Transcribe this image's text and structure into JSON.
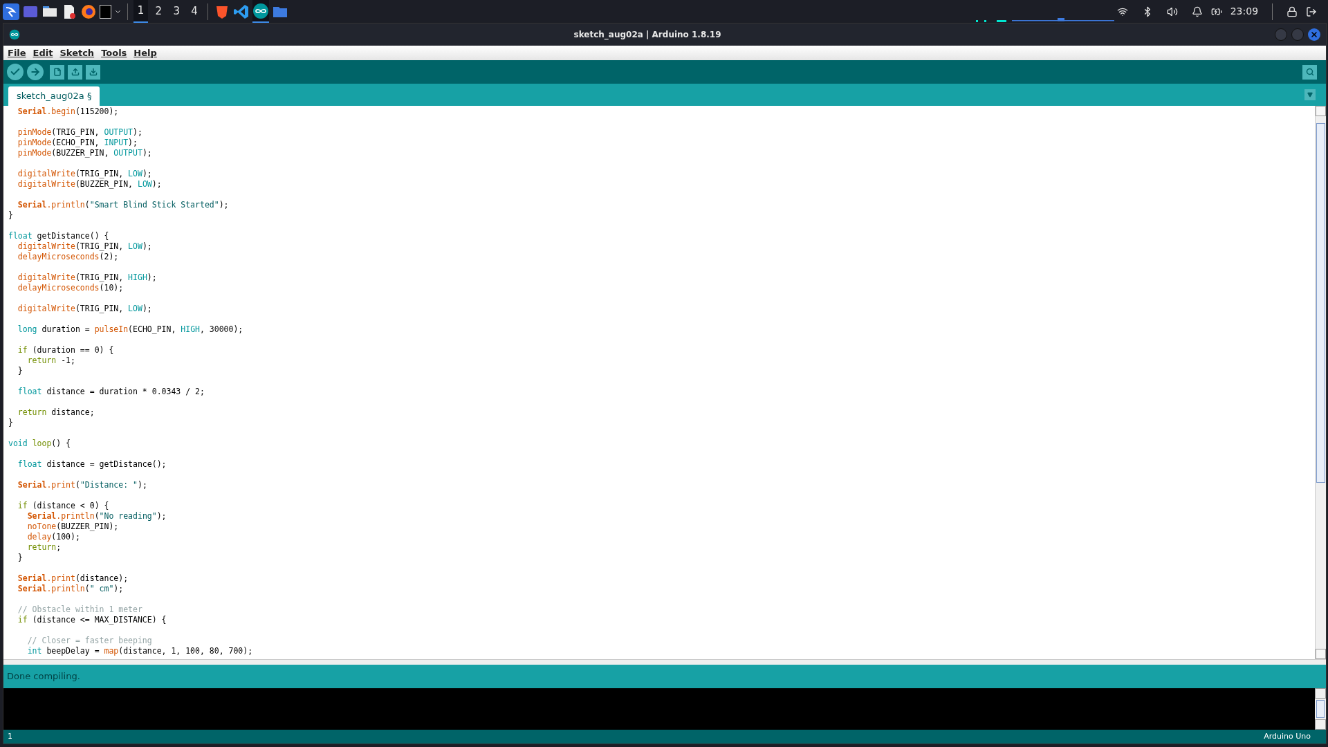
{
  "taskbar": {
    "apps": [
      {
        "selected": false
      },
      {
        "selected": false
      },
      {
        "selected": false
      },
      {
        "selected": false
      },
      {
        "selected": false
      }
    ],
    "workspaces": [
      {
        "label": "1",
        "selected": true
      },
      {
        "label": "2",
        "selected": false
      },
      {
        "label": "3",
        "selected": false
      },
      {
        "label": "4",
        "selected": false
      }
    ],
    "pinned": [
      {
        "selected": false
      },
      {
        "selected": false
      },
      {
        "selected": true
      },
      {
        "selected": false
      }
    ],
    "clock": "23:09"
  },
  "window": {
    "title": "sketch_aug02a | Arduino 1.8.19"
  },
  "menu": [
    "File",
    "Edit",
    "Sketch",
    "Tools",
    "Help"
  ],
  "tabs": [
    {
      "label": "sketch_aug02a §",
      "selected": true
    }
  ],
  "code": {
    "lines": [
      {
        "kind": "code",
        "tokens": [
          {
            "text": "  Serial",
            "kind": "serial"
          },
          {
            "text": ".begin",
            "kind": "function"
          },
          {
            "text": "(115200);",
            "kind": "plain"
          }
        ]
      },
      {
        "kind": "blank"
      },
      {
        "kind": "code",
        "tokens": [
          {
            "text": "  pinMode",
            "kind": "function"
          },
          {
            "text": "(TRIG_PIN, ",
            "kind": "plain"
          },
          {
            "text": "OUTPUT",
            "kind": "constant"
          },
          {
            "text": ");",
            "kind": "plain"
          }
        ]
      },
      {
        "kind": "code",
        "tokens": [
          {
            "text": "  pinMode",
            "kind": "function"
          },
          {
            "text": "(ECHO_PIN, ",
            "kind": "plain"
          },
          {
            "text": "INPUT",
            "kind": "constant"
          },
          {
            "text": ");",
            "kind": "plain"
          }
        ]
      },
      {
        "kind": "code",
        "tokens": [
          {
            "text": "  pinMode",
            "kind": "function"
          },
          {
            "text": "(BUZZER_PIN, ",
            "kind": "plain"
          },
          {
            "text": "OUTPUT",
            "kind": "constant"
          },
          {
            "text": ");",
            "kind": "plain"
          }
        ]
      },
      {
        "kind": "blank"
      },
      {
        "kind": "code",
        "tokens": [
          {
            "text": "  digitalWrite",
            "kind": "function"
          },
          {
            "text": "(TRIG_PIN, ",
            "kind": "plain"
          },
          {
            "text": "LOW",
            "kind": "constant"
          },
          {
            "text": ");",
            "kind": "plain"
          }
        ]
      },
      {
        "kind": "code",
        "tokens": [
          {
            "text": "  digitalWrite",
            "kind": "function"
          },
          {
            "text": "(BUZZER_PIN, ",
            "kind": "plain"
          },
          {
            "text": "LOW",
            "kind": "constant"
          },
          {
            "text": ");",
            "kind": "plain"
          }
        ]
      },
      {
        "kind": "blank"
      },
      {
        "kind": "code",
        "tokens": [
          {
            "text": "  Serial",
            "kind": "serial"
          },
          {
            "text": ".println",
            "kind": "function"
          },
          {
            "text": "(",
            "kind": "plain"
          },
          {
            "text": "\"Smart Blind Stick Started\"",
            "kind": "string"
          },
          {
            "text": ");",
            "kind": "plain"
          }
        ]
      },
      {
        "kind": "code",
        "tokens": [
          {
            "text": "}",
            "kind": "plain"
          }
        ]
      },
      {
        "kind": "blank"
      },
      {
        "kind": "code",
        "tokens": [
          {
            "text": "float",
            "kind": "constant"
          },
          {
            "text": " getDistance() {",
            "kind": "plain"
          }
        ]
      },
      {
        "kind": "code",
        "tokens": [
          {
            "text": "  digitalWrite",
            "kind": "function"
          },
          {
            "text": "(TRIG_PIN, ",
            "kind": "plain"
          },
          {
            "text": "LOW",
            "kind": "constant"
          },
          {
            "text": ");",
            "kind": "plain"
          }
        ]
      },
      {
        "kind": "code",
        "tokens": [
          {
            "text": "  delayMicroseconds",
            "kind": "function"
          },
          {
            "text": "(2);",
            "kind": "plain"
          }
        ]
      },
      {
        "kind": "blank"
      },
      {
        "kind": "code",
        "tokens": [
          {
            "text": "  digitalWrite",
            "kind": "function"
          },
          {
            "text": "(TRIG_PIN, ",
            "kind": "plain"
          },
          {
            "text": "HIGH",
            "kind": "constant"
          },
          {
            "text": ");",
            "kind": "plain"
          }
        ]
      },
      {
        "kind": "code",
        "tokens": [
          {
            "text": "  delayMicroseconds",
            "kind": "function"
          },
          {
            "text": "(10);",
            "kind": "plain"
          }
        ]
      },
      {
        "kind": "blank"
      },
      {
        "kind": "code",
        "tokens": [
          {
            "text": "  digitalWrite",
            "kind": "function"
          },
          {
            "text": "(TRIG_PIN, ",
            "kind": "plain"
          },
          {
            "text": "LOW",
            "kind": "constant"
          },
          {
            "text": ");",
            "kind": "plain"
          }
        ]
      },
      {
        "kind": "blank"
      },
      {
        "kind": "code",
        "tokens": [
          {
            "text": "  long",
            "kind": "constant"
          },
          {
            "text": " duration = ",
            "kind": "plain"
          },
          {
            "text": "pulseIn",
            "kind": "function"
          },
          {
            "text": "(ECHO_PIN, ",
            "kind": "plain"
          },
          {
            "text": "HIGH",
            "kind": "constant"
          },
          {
            "text": ", 30000);",
            "kind": "plain"
          }
        ]
      },
      {
        "kind": "blank"
      },
      {
        "kind": "code",
        "tokens": [
          {
            "text": "  if",
            "kind": "control"
          },
          {
            "text": " (duration == 0) {",
            "kind": "plain"
          }
        ]
      },
      {
        "kind": "code",
        "tokens": [
          {
            "text": "    return",
            "kind": "control"
          },
          {
            "text": " -1;",
            "kind": "plain"
          }
        ]
      },
      {
        "kind": "code",
        "tokens": [
          {
            "text": "  }",
            "kind": "plain"
          }
        ]
      },
      {
        "kind": "blank"
      },
      {
        "kind": "code",
        "tokens": [
          {
            "text": "  float",
            "kind": "constant"
          },
          {
            "text": " distance = duration * 0.0343 / 2;",
            "kind": "plain"
          }
        ]
      },
      {
        "kind": "blank"
      },
      {
        "kind": "code",
        "tokens": [
          {
            "text": "  return",
            "kind": "control"
          },
          {
            "text": " distance;",
            "kind": "plain"
          }
        ]
      },
      {
        "kind": "code",
        "tokens": [
          {
            "text": "}",
            "kind": "plain"
          }
        ]
      },
      {
        "kind": "blank"
      },
      {
        "kind": "code",
        "tokens": [
          {
            "text": "void",
            "kind": "constant"
          },
          {
            "text": " loop",
            "kind": "control"
          },
          {
            "text": "() {",
            "kind": "plain"
          }
        ]
      },
      {
        "kind": "blank"
      },
      {
        "kind": "code",
        "tokens": [
          {
            "text": "  float",
            "kind": "constant"
          },
          {
            "text": " distance = getDistance();",
            "kind": "plain"
          }
        ]
      },
      {
        "kind": "blank"
      },
      {
        "kind": "code",
        "tokens": [
          {
            "text": "  Serial",
            "kind": "serial"
          },
          {
            "text": ".print",
            "kind": "function"
          },
          {
            "text": "(",
            "kind": "plain"
          },
          {
            "text": "\"Distance: \"",
            "kind": "string"
          },
          {
            "text": ");",
            "kind": "plain"
          }
        ]
      },
      {
        "kind": "blank"
      },
      {
        "kind": "code",
        "tokens": [
          {
            "text": "  if",
            "kind": "control"
          },
          {
            "text": " (distance < 0) {",
            "kind": "plain"
          }
        ]
      },
      {
        "kind": "code",
        "tokens": [
          {
            "text": "    Serial",
            "kind": "serial"
          },
          {
            "text": ".println",
            "kind": "function"
          },
          {
            "text": "(",
            "kind": "plain"
          },
          {
            "text": "\"No reading\"",
            "kind": "string"
          },
          {
            "text": ");",
            "kind": "plain"
          }
        ]
      },
      {
        "kind": "code",
        "tokens": [
          {
            "text": "    noTone",
            "kind": "function"
          },
          {
            "text": "(BUZZER_PIN);",
            "kind": "plain"
          }
        ]
      },
      {
        "kind": "code",
        "tokens": [
          {
            "text": "    delay",
            "kind": "function"
          },
          {
            "text": "(100);",
            "kind": "plain"
          }
        ]
      },
      {
        "kind": "code",
        "tokens": [
          {
            "text": "    return",
            "kind": "control"
          },
          {
            "text": ";",
            "kind": "plain"
          }
        ]
      },
      {
        "kind": "code",
        "tokens": [
          {
            "text": "  }",
            "kind": "plain"
          }
        ]
      },
      {
        "kind": "blank"
      },
      {
        "kind": "code",
        "tokens": [
          {
            "text": "  Serial",
            "kind": "serial"
          },
          {
            "text": ".print",
            "kind": "function"
          },
          {
            "text": "(distance);",
            "kind": "plain"
          }
        ]
      },
      {
        "kind": "code",
        "tokens": [
          {
            "text": "  Serial",
            "kind": "serial"
          },
          {
            "text": ".println",
            "kind": "function"
          },
          {
            "text": "(",
            "kind": "plain"
          },
          {
            "text": "\" cm\"",
            "kind": "string"
          },
          {
            "text": ");",
            "kind": "plain"
          }
        ]
      },
      {
        "kind": "blank"
      },
      {
        "kind": "code",
        "tokens": [
          {
            "text": "  // Obstacle within 1 meter",
            "kind": "comment"
          }
        ]
      },
      {
        "kind": "code",
        "tokens": [
          {
            "text": "  if",
            "kind": "control"
          },
          {
            "text": " (distance <= MAX_DISTANCE) {",
            "kind": "plain"
          }
        ]
      },
      {
        "kind": "blank"
      },
      {
        "kind": "code",
        "tokens": [
          {
            "text": "    // Closer = faster beeping",
            "kind": "comment"
          }
        ]
      },
      {
        "kind": "code",
        "tokens": [
          {
            "text": "    int",
            "kind": "constant"
          },
          {
            "text": " beepDelay = ",
            "kind": "plain"
          },
          {
            "text": "map",
            "kind": "function"
          },
          {
            "text": "(distance, 1, 100, 80, 700);",
            "kind": "plain"
          }
        ]
      }
    ]
  },
  "message": "Done compiling.",
  "status_bar": {
    "line": "1",
    "board": "Arduino Uno"
  }
}
